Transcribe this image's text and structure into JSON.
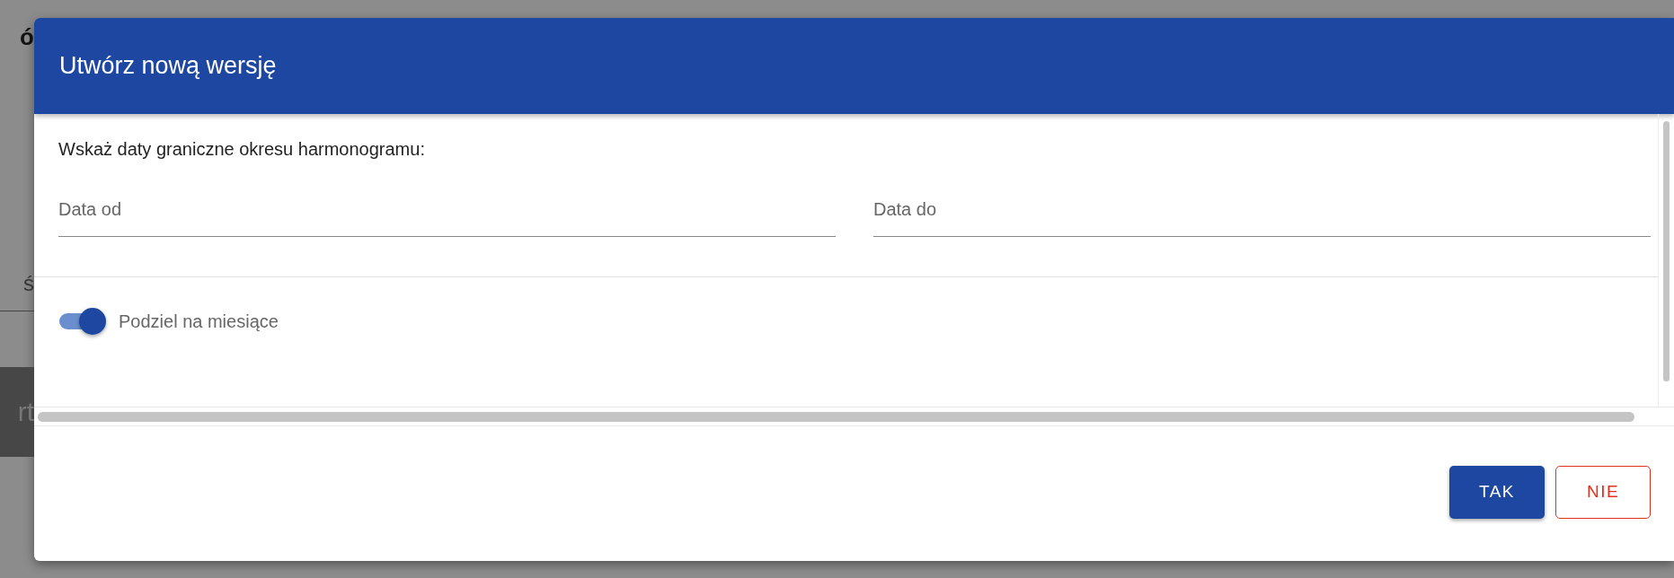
{
  "background": {
    "fragments": [
      {
        "text": "ó",
        "kind": "heading"
      },
      {
        "text": "ś",
        "kind": "field"
      },
      {
        "text": "rt",
        "kind": "bar"
      }
    ]
  },
  "dialog": {
    "title": "Utwórz nową wersję",
    "prompt": "Wskaż daty graniczne okresu harmonogramu:",
    "fields": [
      {
        "placeholder": "Data od"
      },
      {
        "placeholder": "Data do"
      }
    ],
    "toggle": {
      "label": "Podziel na miesiące",
      "on": true
    },
    "buttons": [
      {
        "label": "TAK",
        "kind": "primary"
      },
      {
        "label": "NIE",
        "kind": "secondary"
      }
    ]
  }
}
